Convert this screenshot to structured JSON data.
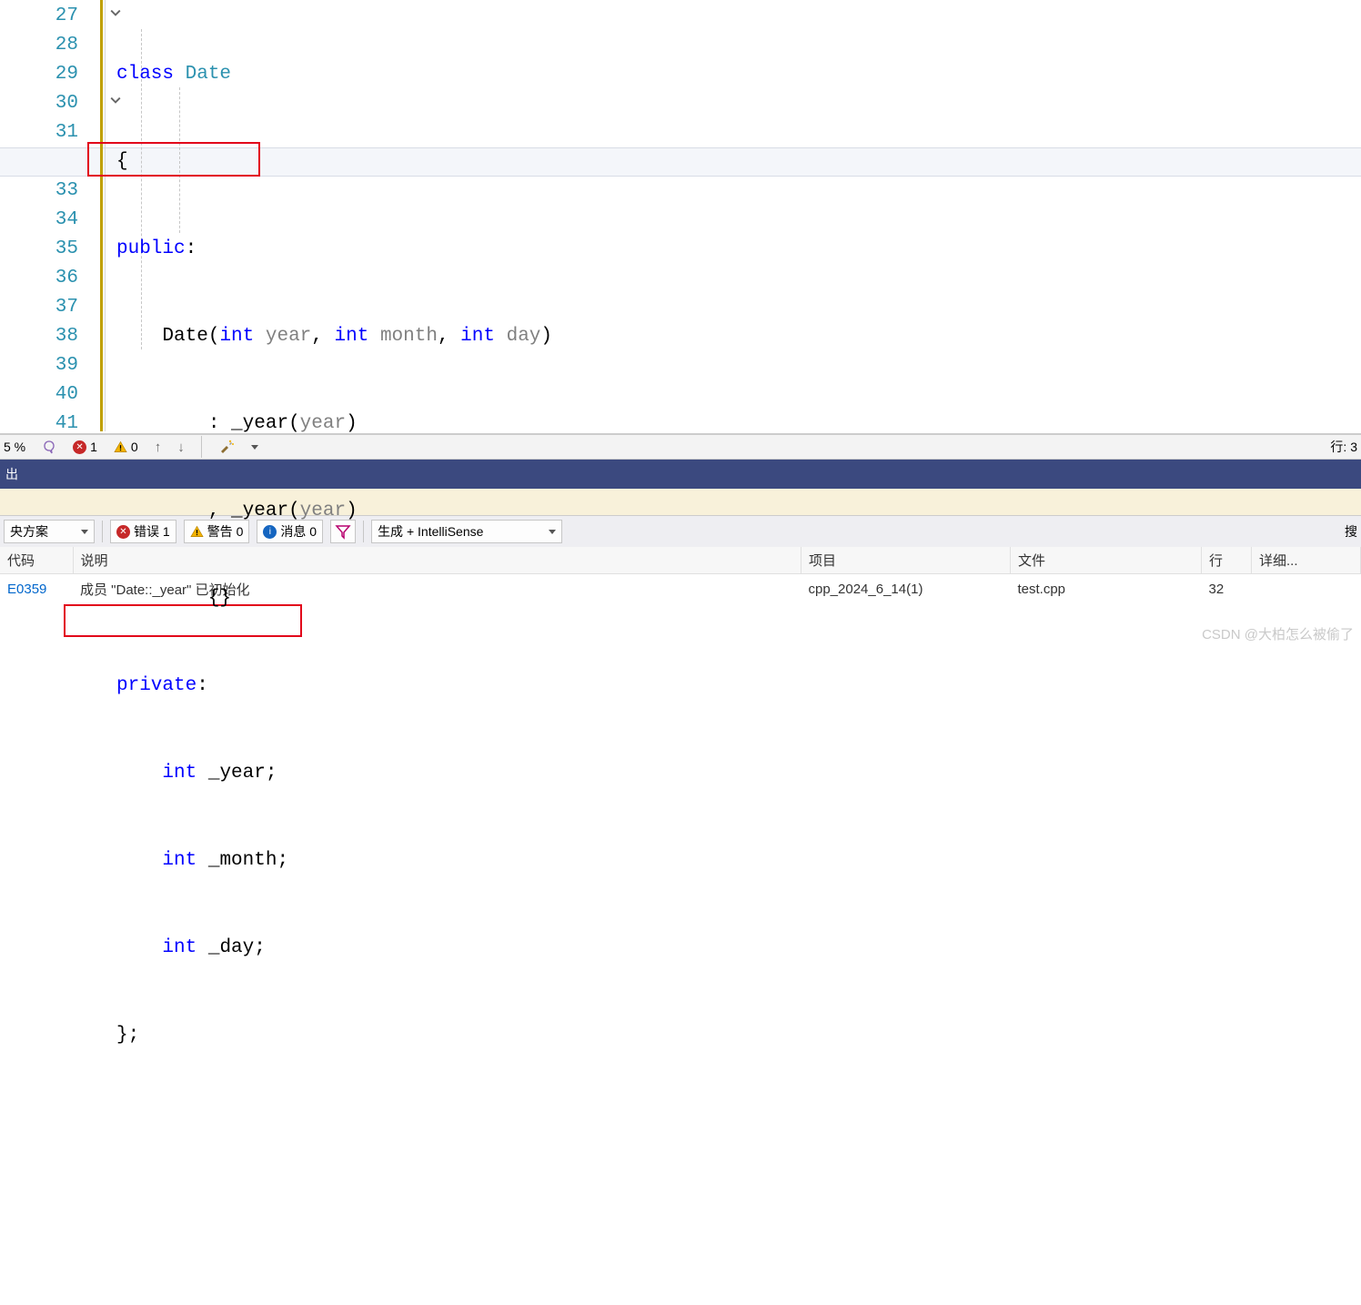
{
  "lines": {
    "start": 27,
    "end": 41
  },
  "code": {
    "l27": {
      "kw_class": "class",
      "type_Date": "Date"
    },
    "l28": {
      "brace": "{"
    },
    "l29": {
      "kw_public": "public",
      "colon": ":"
    },
    "l30": {
      "ctor": "Date",
      "lp": "(",
      "kw_int1": "int",
      "p_year": "year",
      "c1": ",",
      "kw_int2": "int",
      "p_month": "month",
      "c2": ",",
      "kw_int3": "int",
      "p_day": "day",
      "rp": ")"
    },
    "l31": {
      "colon": ":",
      "m_year": "_year",
      "lp": "(",
      "arg": "year",
      "rp": ")"
    },
    "l32": {
      "comma": ",",
      "m_year": "_year",
      "lp": "(",
      "arg": "year",
      "rp": ")"
    },
    "l33": {
      "braces": "{}"
    },
    "l34": {
      "kw_private": "private",
      "colon": ":"
    },
    "l35": {
      "kw_int": "int",
      "m": "_year",
      "semi": ";"
    },
    "l36": {
      "kw_int": "int",
      "m": "_month",
      "semi": ";"
    },
    "l37": {
      "kw_int": "int",
      "m": "_day",
      "semi": ";"
    },
    "l38": {
      "brace": "}",
      "semi": ";"
    }
  },
  "toolbar": {
    "zoom": "5 %",
    "error_count": "1",
    "warn_count": "0",
    "line_label": "行: 3"
  },
  "bluebar": {
    "text": "出"
  },
  "filterbar": {
    "solution": "央方案",
    "errors_btn": "错误 1",
    "warnings_btn": "警告 0",
    "messages_btn": "消息 0",
    "build_combo": "生成 + IntelliSense",
    "search_label": "搜"
  },
  "error_table": {
    "headers": {
      "code": "代码",
      "desc": "说明",
      "proj": "项目",
      "file": "文件",
      "line": "行",
      "detail": "详细..."
    },
    "row": {
      "code": "E0359",
      "desc": "成员 \"Date::_year\" 已初始化",
      "proj": "cpp_2024_6_14(1)",
      "file": "test.cpp",
      "line": "32"
    }
  },
  "watermark": "CSDN @大柏怎么被偷了"
}
